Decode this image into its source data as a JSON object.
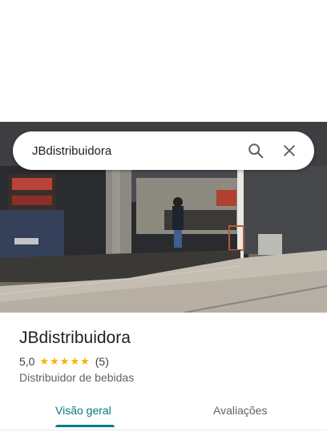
{
  "search": {
    "query": "JBdistribuidora"
  },
  "place": {
    "name": "JBdistribuidora",
    "rating": "5,0",
    "stars": 5,
    "review_count": "(5)",
    "category": "Distribuidor de bebidas"
  },
  "tabs": [
    {
      "label": "Visão geral",
      "active": true
    },
    {
      "label": "Avaliações",
      "active": false
    }
  ],
  "icons": {
    "search": "search-icon",
    "close": "close-icon",
    "star": "star-icon"
  },
  "colors": {
    "accent": "#007b83",
    "star": "#f4b400"
  }
}
